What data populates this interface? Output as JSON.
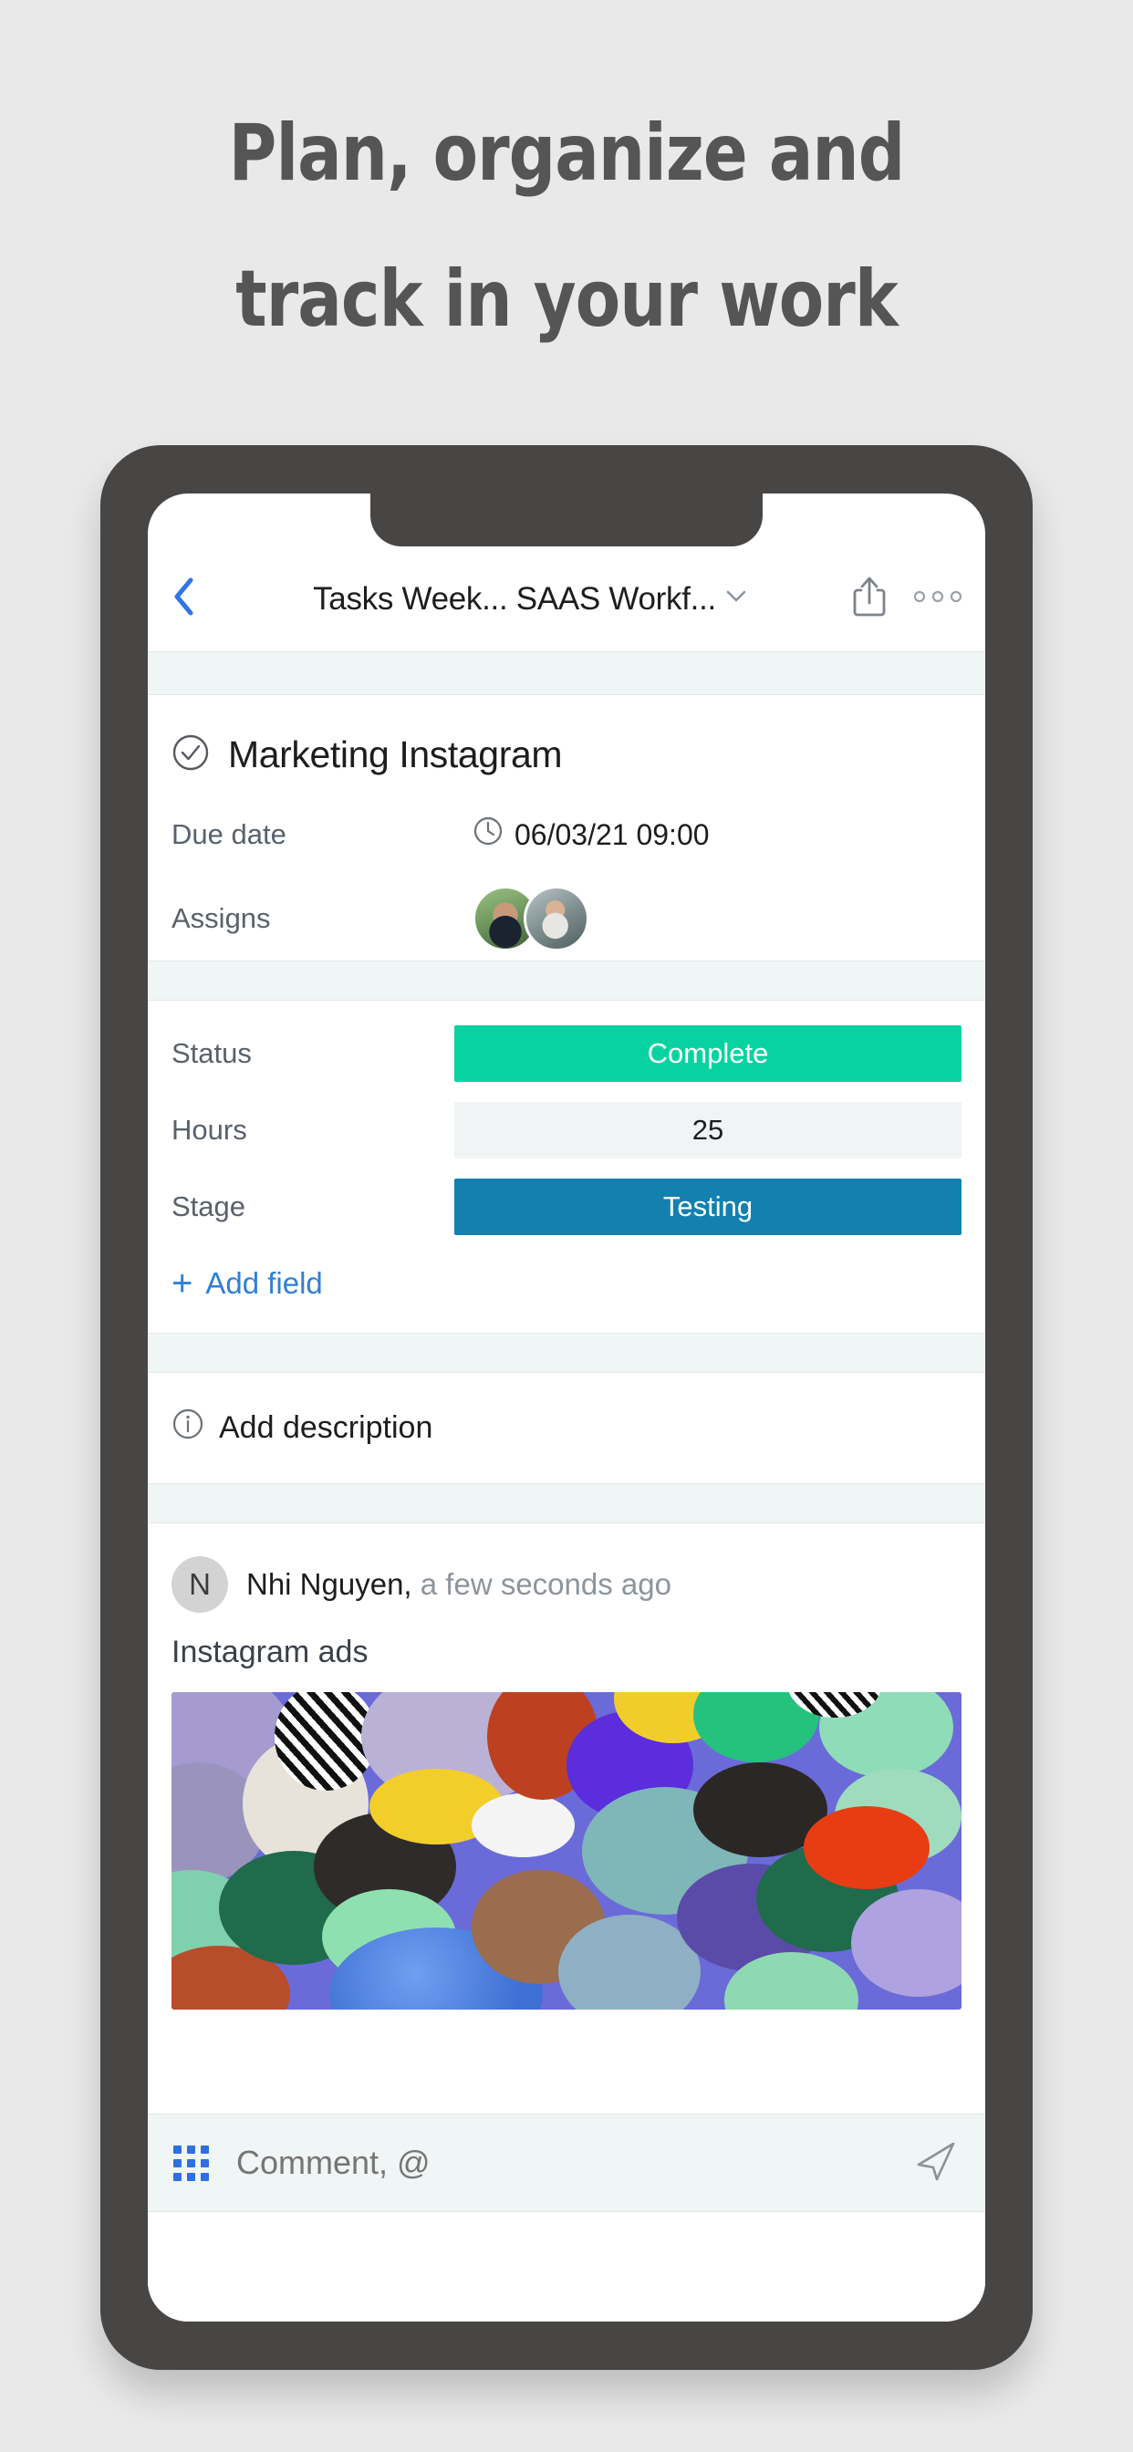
{
  "headline": {
    "line1": "Plan, organize and",
    "line2": "track in your work",
    "color": "#555555"
  },
  "colors": {
    "background": "#e9e9e9",
    "phone_frame": "#474645",
    "accent_blue": "#2f80d8",
    "status_green": "#08d3a0",
    "stage_blue": "#1380b0",
    "strip": "#f0f5f5",
    "muted_text": "#59616b"
  },
  "navbar": {
    "back_icon": "chevron-left-icon",
    "title": "Tasks Week... SAAS Workf...",
    "dropdown_icon": "chevron-down-icon",
    "share_icon": "share-icon",
    "more_icon": "more-horizontal-icon"
  },
  "task": {
    "check_icon": "check-circle-icon",
    "title": "Marketing Instagram",
    "fields": [
      {
        "label": "Due date",
        "icon": "clock-icon",
        "value": "06/03/21 09:00"
      },
      {
        "label": "Assigns",
        "icon": "avatar-group",
        "value": ""
      }
    ]
  },
  "attributes": [
    {
      "label": "Status",
      "value": "Complete",
      "style": "green"
    },
    {
      "label": "Hours",
      "value": "25",
      "style": "neutral"
    },
    {
      "label": "Stage",
      "value": "Testing",
      "style": "blue"
    }
  ],
  "add_field": {
    "icon": "plus-icon",
    "label": "Add field"
  },
  "description": {
    "icon": "info-circle-icon",
    "label": "Add description"
  },
  "comment": {
    "avatar_initial": "N",
    "author": "Nhi Nguyen,",
    "timestamp": "a few seconds ago",
    "text": "Instagram ads",
    "attachment_alt": "colored-pebbles-photo"
  },
  "comment_bar": {
    "grid_icon": "apps-grid-icon",
    "placeholder": "Comment, @",
    "send_icon": "send-icon"
  }
}
